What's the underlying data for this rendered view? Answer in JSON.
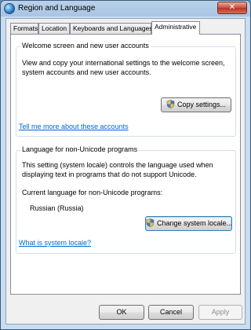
{
  "window": {
    "title": "Region and Language",
    "close_label": "✕"
  },
  "tabs": [
    {
      "label": "Formats"
    },
    {
      "label": "Location"
    },
    {
      "label": "Keyboards and Languages"
    },
    {
      "label": "Administrative",
      "active": true
    }
  ],
  "welcome_group": {
    "title": "Welcome screen and new user accounts",
    "line1": "View and copy your international settings to the welcome screen,",
    "line2": "system accounts and new user accounts.",
    "copy_button": "Copy settings...",
    "link": "Tell me more about these accounts"
  },
  "unicode_group": {
    "title": "Language for non-Unicode programs",
    "line1": "This setting (system locale) controls the language used when",
    "line2": "displaying text in programs that do not support Unicode.",
    "current_label": "Current language for non-Unicode programs:",
    "current_value": "Russian (Russia)",
    "change_button": "Change system locale...",
    "link": "What is system locale?"
  },
  "buttons": {
    "ok": "OK",
    "cancel": "Cancel",
    "apply": "Apply"
  },
  "icons": {
    "window": "globe-icon",
    "uac": "uac-shield-icon"
  }
}
